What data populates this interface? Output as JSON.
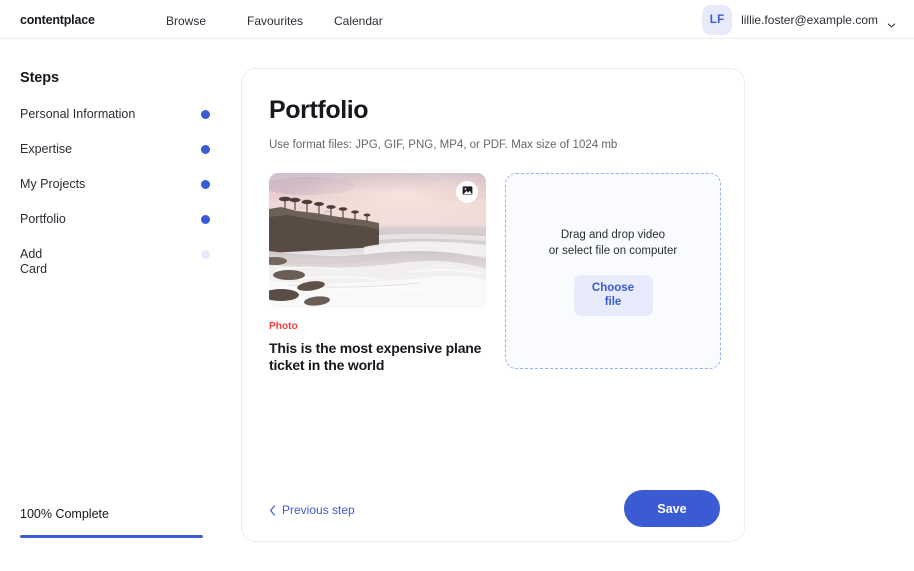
{
  "header": {
    "brand": "contentplace",
    "nav": [
      {
        "label": "Browse"
      },
      {
        "label": "Favourites"
      },
      {
        "label": "Calendar"
      }
    ],
    "account": {
      "initials": "LF",
      "email": "lillie.foster@example.com",
      "chevron_icon": "chevron-down-icon"
    }
  },
  "sidebar": {
    "title": "Steps",
    "items": [
      {
        "label": "Personal Information",
        "state": "done"
      },
      {
        "label": "Expertise",
        "state": "done"
      },
      {
        "label": "My Projects",
        "state": "done"
      },
      {
        "label": "Portfolio",
        "state": "done"
      },
      {
        "label": "Add Card",
        "state": "pending"
      }
    ],
    "progress": {
      "label": "100% Complete",
      "percent": 100
    }
  },
  "main": {
    "title": "Portfolio",
    "subtitle": "Use format files: JPG, GIF, PNG, MP4, or PDF. Max size of 1024 mb",
    "media_card": {
      "image_alt": "coastal sunset with waves and palm trees",
      "badge_icon": "image-icon",
      "tag": "Photo",
      "title": "This is the most expensive plane ticket in the world"
    },
    "dropzone": {
      "line1": "Drag and drop video",
      "line2": "or select file on computer",
      "button_line1": "Choose",
      "button_line2": "file"
    },
    "footer": {
      "previous_label": "Previous step",
      "previous_icon": "chevron-left-icon",
      "save_label": "Save"
    }
  },
  "colors": {
    "accent": "#3b5bd4",
    "accent_soft": "#e8ebfb",
    "tag_red": "#ef3c3c",
    "text_primary": "#16181d",
    "text_muted": "#63676f"
  }
}
